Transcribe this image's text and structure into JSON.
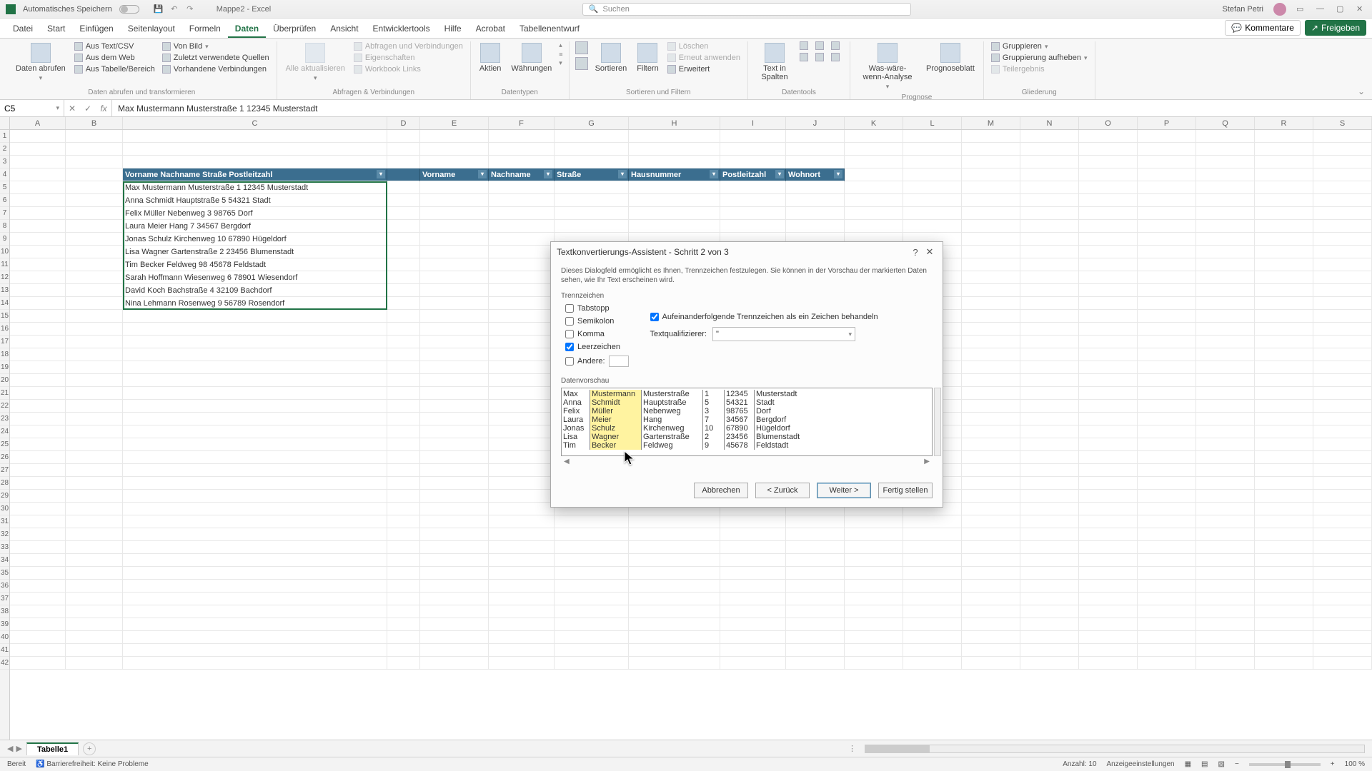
{
  "titlebar": {
    "autosave": "Automatisches Speichern",
    "doc_title": "Mappe2 - Excel",
    "search_placeholder": "Suchen",
    "user": "Stefan Petri"
  },
  "tabs": [
    "Datei",
    "Start",
    "Einfügen",
    "Seitenlayout",
    "Formeln",
    "Daten",
    "Überprüfen",
    "Ansicht",
    "Entwicklertools",
    "Hilfe",
    "Acrobat",
    "Tabellenentwurf"
  ],
  "active_tab": "Daten",
  "comments_btn": "Kommentare",
  "share_btn": "Freigeben",
  "ribbon": {
    "g1": {
      "main": "Daten abrufen",
      "items": [
        "Aus Text/CSV",
        "Aus dem Web",
        "Aus Tabelle/Bereich",
        "Von Bild",
        "Zuletzt verwendete Quellen",
        "Vorhandene Verbindungen"
      ],
      "title": "Daten abrufen und transformieren"
    },
    "g2": {
      "main": "Alle aktualisieren",
      "items": [
        "Abfragen und Verbindungen",
        "Eigenschaften",
        "Workbook Links"
      ],
      "title": "Abfragen & Verbindungen"
    },
    "g3": {
      "items": [
        "Aktien",
        "Währungen"
      ],
      "title": "Datentypen"
    },
    "g4": {
      "sort": "Sortieren",
      "filter": "Filtern",
      "items": [
        "Löschen",
        "Erneut anwenden",
        "Erweitert"
      ],
      "title": "Sortieren und Filtern"
    },
    "g5": {
      "main": "Text in Spalten",
      "title": "Datentools"
    },
    "g6": {
      "main": "Was-wäre-wenn-Analyse",
      "prog": "Prognoseblatt",
      "title": "Prognose"
    },
    "g7": {
      "items": [
        "Gruppieren",
        "Gruppierung aufheben",
        "Teilergebnis"
      ],
      "title": "Gliederung"
    }
  },
  "name_box": "C5",
  "formula": "Max Mustermann Musterstraße 1 12345 Musterstadt",
  "columns": [
    "A",
    "B",
    "C",
    "D",
    "E",
    "F",
    "G",
    "H",
    "I",
    "J",
    "K",
    "L",
    "M",
    "N",
    "O",
    "P",
    "Q",
    "R",
    "S"
  ],
  "row_start": 1,
  "row_end": 42,
  "table": {
    "headerC": "Vorname Nachname Straße Postleitzahl",
    "headers2": [
      "Vorname",
      "Nachname",
      "Straße",
      "Hausnummer",
      "Postleitzahl",
      "Wohnort"
    ],
    "rows": [
      "Max Mustermann Musterstraße 1 12345 Musterstadt",
      "Anna Schmidt Hauptstraße 5 54321 Stadt",
      "Felix Müller Nebenweg 3 98765 Dorf",
      "Laura Meier Hang 7 34567 Bergdorf",
      "Jonas Schulz Kirchenweg 10 67890 Hügeldorf",
      "Lisa Wagner Gartenstraße 2 23456 Blumenstadt",
      "Tim Becker Feldweg 98 45678 Feldstadt",
      "Sarah Hoffmann Wiesenweg 6 78901 Wiesendorf",
      "David Koch Bachstraße 4 32109 Bachdorf",
      "Nina Lehmann Rosenweg 9 56789 Rosendorf"
    ]
  },
  "dialog": {
    "title": "Textkonvertierungs-Assistent - Schritt 2 von 3",
    "desc": "Dieses Dialogfeld ermöglicht es Ihnen, Trennzeichen festzulegen. Sie können in der Vorschau der markierten Daten sehen, wie Ihr Text erscheinen wird.",
    "delim_label": "Trennzeichen",
    "delims": {
      "tab": "Tabstopp",
      "semicolon": "Semikolon",
      "comma": "Komma",
      "space": "Leerzeichen",
      "other": "Andere:"
    },
    "consecutive": "Aufeinanderfolgende Trennzeichen als ein Zeichen behandeln",
    "qualifier_label": "Textqualifizierer:",
    "qualifier_value": "\"",
    "preview_label": "Datenvorschau",
    "preview": [
      [
        "Max",
        "Mustermann",
        "Musterstraße",
        "1",
        "12345",
        "Musterstadt"
      ],
      [
        "Anna",
        "Schmidt",
        "Hauptstraße",
        "5",
        "54321",
        "Stadt"
      ],
      [
        "Felix",
        "Müller",
        "Nebenweg",
        "3",
        "98765",
        "Dorf"
      ],
      [
        "Laura",
        "Meier",
        "Hang",
        "7",
        "34567",
        "Bergdorf"
      ],
      [
        "Jonas",
        "Schulz",
        "Kirchenweg",
        "10",
        "67890",
        "Hügeldorf"
      ],
      [
        "Lisa",
        "Wagner",
        "Gartenstraße",
        "2",
        "23456",
        "Blumenstadt"
      ],
      [
        "Tim",
        "Becker",
        "Feldweg",
        "9",
        "45678",
        "Feldstadt"
      ]
    ],
    "buttons": {
      "cancel": "Abbrechen",
      "back": "< Zurück",
      "next": "Weiter >",
      "finish": "Fertig stellen"
    }
  },
  "sheet_tab": "Tabelle1",
  "status": {
    "ready": "Bereit",
    "access": "Barrierefreiheit: Keine Probleme",
    "count_label": "Anzahl:",
    "count_value": "10",
    "display_settings": "Anzeigeeinstellungen",
    "zoom": "100 %"
  }
}
